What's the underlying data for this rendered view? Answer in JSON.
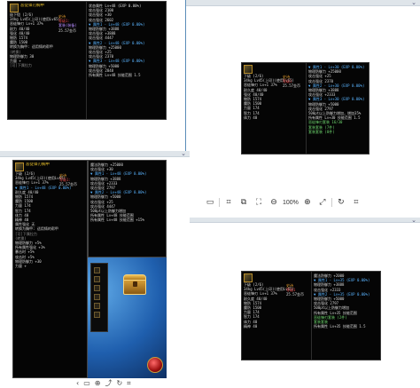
{
  "windows": {
    "w1": {
      "title": "恶徒锋刃胸甲",
      "left": [
        "极下铠 (2/6)",
        "34kg  Lv45(上印)(使用Lv65)",
        "恶徒锋刃 Lv+1 37%",
        "耐力 40/40",
        "   强化 40/40",
        "物防 1574",
        "魔防 1500",
        "转换为胸甲: 适用铸的帮甲",
        "(转换)",
        "物理防御力 30",
        "力量 +",
        "[可]下属拉力"
      ],
      "right": [
        "状态属性 Lv+48 (EXP 0.00%)",
        "  攻击强化 2100",
        "  攻击强化 +30",
        "  攻击强化 2602",
        "▼ 属性1 - Lv+48 (EXP 0.00%)",
        "  物理防御力 +3888",
        "  攻击强化 +3888",
        "  攻击强化 4447",
        "▼ 属性2 - Lv+48 (EXP 0.00%)",
        "  物理防御力 +25000",
        "  攻击强化 +25",
        "  攻击强化 2370",
        "▼ 属性3 - Lv+48 (EXP 0.00%)",
        "  物理防御力 +5000",
        "  攻击强化 2848",
        "所有属性 Lv+48 技能范围 1.5"
      ],
      "badges": [
        "史诗",
        "等级1:",
        "套装(装备)",
        "25.57金币"
      ]
    },
    "w2": {
      "left": [
        "下级  (2/6)",
        "34kg  Lv45(上印)(使用Lv65)",
        "恶徒锋刃 Lv+1 37%",
        "耐久度 40/40",
        "   强化 40/40",
        "物防 1574",
        "魔防 1500",
        "力量 174",
        "智力 174",
        "体力 40"
      ],
      "right": [
        "▼ 属性1 - Lv+30 (EXP 0.00%)",
        "  物理防御力 +25000",
        "  攻击强化 +25",
        "  攻击强化 2370",
        "▼ 属性2 - Lv+30 (EXP 0.00%)",
        "  物理防御力 +3888",
        "  攻击强化 +2333",
        "▼ 属性3 - Lv+30 (EXP 0.00%)",
        "  物理防御力 +5000",
        "  攻击强化 2797",
        "  500pt以上防御力增加，增加35%",
        "  所有属性 Lv+30 技能范围 1.5",
        "恶徒锋刃套装 16/30",
        "  套装套装 (7件)",
        "  套装套装 (8件)"
      ],
      "badges": [
        "史诗",
        "等级1",
        "25.57金币"
      ]
    },
    "w3": {
      "title": "恶徒锋刃胸甲",
      "left": [
        "下级  (2/6)",
        "34kg  Lv45(上印)(使用Lv65)",
        "恶徒锋刃 Lv+1 37%",
        "▼ 属性1 - Lv+48 (EXP 0.00%)",
        "耐久度 40/40",
        "物防 1574",
        "魔防 1500",
        "力量 174",
        "智力 174",
        "体力 40",
        "精神 40",
        "属性强化 无",
        "转换为胸甲: 适用铸的帮甲",
        "[可]下属拉力",
        "(转换)",
        "物理防御力 +5%",
        "所有属性强化 +1%",
        "暴击时 +5%",
        "攻击时 +5%",
        "物理防御力 +30",
        "力量 +"
      ],
      "right": [
        "魔法防御力 +25000",
        "  攻击强化 +30",
        "▼ 属性1 - Lv+48 (EXP 0.00%)",
        "  物理防御力 +3888",
        "  攻击强化 +2333",
        "  攻击强化 2797",
        "▼ 属性2 - Lv+48 (EXP 0.00%)",
        "  物理防御力 +5000",
        "  攻击强化 +25",
        "  攻击强化 4447",
        "  500pt以上防御力增加",
        "  所有属性 Lv+48 技能范围",
        "所有属性 Lv+48 技能范围 +15%"
      ],
      "badges": [
        "史诗",
        "等级1:",
        "25.57金币"
      ]
    },
    "w4": {
      "left": [
        "下级  (2/6)",
        "34kg  Lv45(上印)(使用Lv65)",
        "恶徒锋刃 Lv+1 37%",
        "耐久度 40/40",
        "物防 1574",
        "魔防 1500",
        "力量 174",
        "智力 174",
        "体力 40",
        "精神 40"
      ],
      "right": [
        "魔法防御力 +2000",
        "▼ 属性1 - Lv+35 (EXP 0.00%)",
        "  物理防御力 +3888",
        "  攻击强化 +2333",
        "▼ 属性2 - Lv+35 (EXP 0.00%)",
        "  物理防御力 +5000",
        "  攻击强化 2797",
        "  500pt以上防御力增加",
        "  所有属性 Lv+35 技能范围",
        "恶徒锋刃套装 (2件)",
        "  套装套装",
        "所有属性 Lv+35 技能范围 1.5"
      ],
      "badges": [
        "史诗",
        "等级1",
        "25.57金币"
      ]
    }
  },
  "toolbar": {
    "zoom": "100%",
    "icons": [
      "image-icon",
      "scan-icon",
      "copy-icon",
      "fit-icon",
      "zoom-out-icon",
      "zoom-in-icon",
      "expand-icon",
      "rotate-icon",
      "crop-icon"
    ]
  },
  "bottom_icons": [
    "scroll-left-icon",
    "fit-icon",
    "zoom-icon",
    "share-icon",
    "rotate-icon",
    "crop-icon"
  ],
  "colors": {
    "window_bar": "#dfe5ea",
    "accent": "#5b8db8",
    "tooltip_bg": "#050505",
    "title_gold": "#e8c02c"
  }
}
